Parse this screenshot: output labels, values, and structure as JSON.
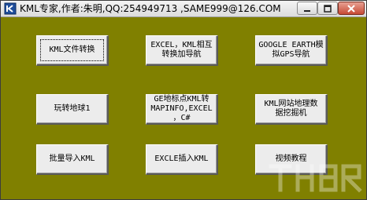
{
  "window": {
    "title": "KML专家,作者:朱明,QQ:254949713 ,SAME999@126.COM"
  },
  "buttons": [
    {
      "label": "KML文件转换"
    },
    {
      "label": "EXCEL，KML相互\n转换加导航"
    },
    {
      "label": "GOOGLE EARTH模\n拟GPS导航"
    },
    {
      "label": "玩转地球1"
    },
    {
      "label": "GE地标点KML转\nMAPINFO,EXCEL\n，C#"
    },
    {
      "label": "KML网站地理数\n据挖掘机"
    },
    {
      "label": "批量导入KML"
    },
    {
      "label": "EXCLE插入KML"
    },
    {
      "label": "视频教程"
    }
  ],
  "colors": {
    "client_bg": "#808000",
    "button_face": "#ececec",
    "close_button": "#c74a35"
  },
  "icons": {
    "app": "kml-app-icon",
    "minimize": "minimize-icon",
    "maximize": "maximize-icon",
    "close": "close-icon"
  }
}
